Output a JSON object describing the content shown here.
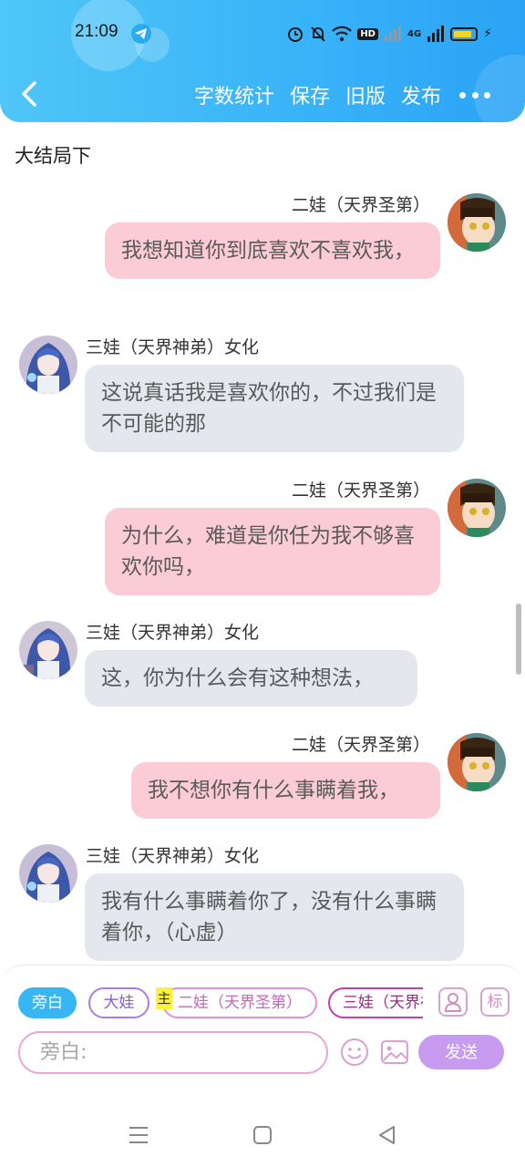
{
  "status_bar": {
    "time": "21:09",
    "hd_label": "HD",
    "network_label": "4G",
    "battery_level": 0.85,
    "colors": {
      "battery": "#f2d52c"
    }
  },
  "navbar": {
    "actions": [
      "字数统计",
      "保存",
      "旧版",
      "发布"
    ],
    "icons": {
      "back": "chevron-left-icon",
      "more": "more-dots-icon"
    },
    "colors": {
      "background": "#3ab4f8",
      "text": "#ffffff"
    }
  },
  "story": {
    "title": "大结局下"
  },
  "messages": [
    {
      "side": "right",
      "sender": "二娃（天界圣第）",
      "text": "我想知道你到底喜欢不喜欢我，",
      "avatar": "anime-boy-avatar"
    },
    {
      "side": "left",
      "sender": "三娃（天界神弟）女化",
      "text": "这说真话我是喜欢你的，不过我们是不可能的那",
      "avatar": "anime-girl-avatar"
    },
    {
      "side": "right",
      "sender": "二娃（天界圣第）",
      "text": "为什么，难道是你任为我不够喜欢你吗，",
      "avatar": "anime-boy-avatar"
    },
    {
      "side": "left",
      "sender": "三娃（天界神弟）女化",
      "text": "这，你为什么会有这种想法，",
      "avatar": "anime-girl-avatar"
    },
    {
      "side": "right",
      "sender": "二娃（天界圣第）",
      "text": "我不想你有什么事瞒着我，",
      "avatar": "anime-boy-avatar"
    },
    {
      "side": "left",
      "sender": "三娃（天界神弟）女化",
      "text": "我有什么事瞒着你了，没有什么事瞒着你，（心虚）",
      "avatar": "anime-girl-avatar"
    }
  ],
  "composer": {
    "roles": [
      {
        "label": "旁白",
        "selected": true
      },
      {
        "label": "大娃",
        "selected": false
      },
      {
        "label": "二娃（天界圣第）",
        "selected": false,
        "badge": "主"
      },
      {
        "label": "三娃（天界神弟）女化",
        "selected": false
      }
    ],
    "tool_icons": [
      "person-icon",
      "tag-icon"
    ],
    "tag_label": "标",
    "input_placeholder": "旁白:",
    "input_icons": [
      "emoji-icon",
      "image-icon"
    ],
    "send_label": "发送",
    "colors": {
      "selected_chip": "#38b6f4",
      "send_button": "#c79bf0",
      "input_border": "#e5a8d8"
    }
  },
  "system_nav": {
    "icons": [
      "menu-icon",
      "home-icon",
      "back-triangle-icon"
    ]
  },
  "colors": {
    "bubble_right": "#fcccd6",
    "bubble_left": "#e4e7ee"
  }
}
